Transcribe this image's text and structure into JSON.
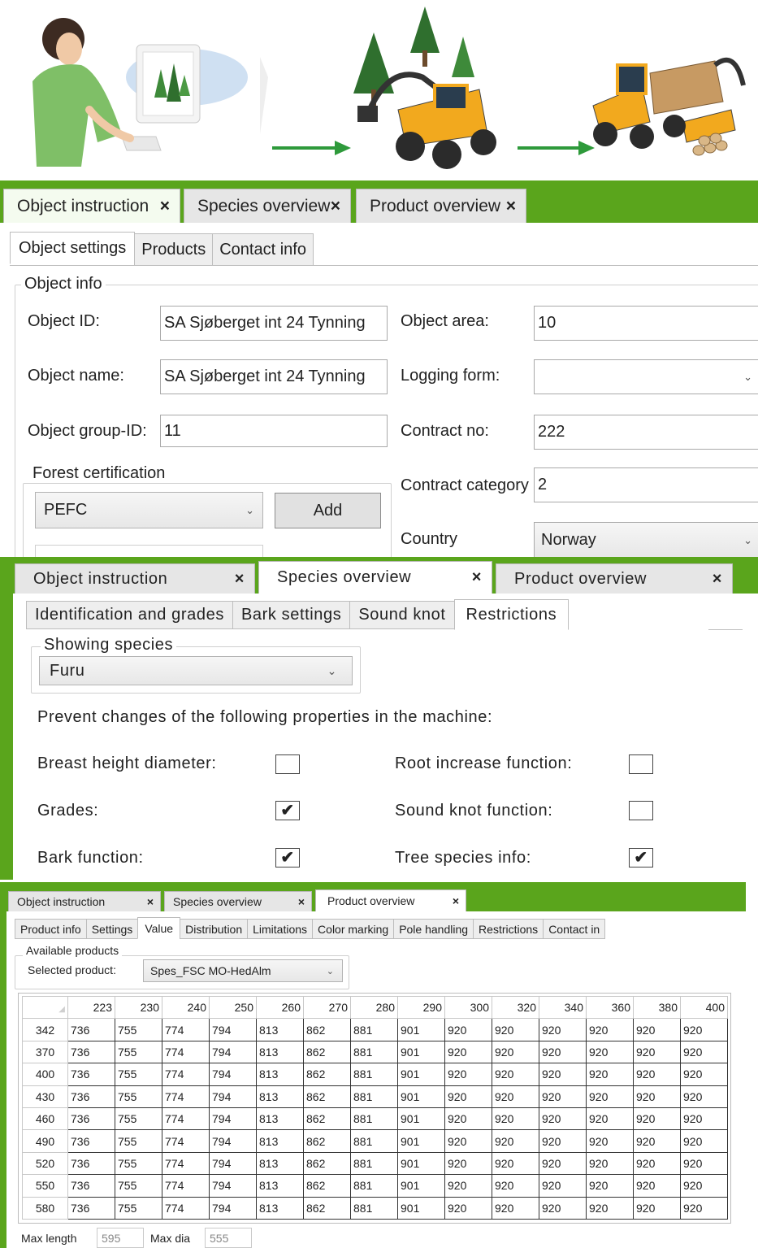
{
  "panel1": {
    "doc_tabs": [
      {
        "label": "Object instruction",
        "close": "×",
        "active": true
      },
      {
        "label": "Species overview",
        "close": "×",
        "active": false
      },
      {
        "label": "Product overview",
        "close": "×",
        "active": false
      }
    ],
    "sub_tabs": [
      "Object settings",
      "Products",
      "Contact info"
    ],
    "object_info": {
      "title": "Object info",
      "object_id_label": "Object ID:",
      "object_id": "SA Sjøberget int 24 Tynning",
      "object_name_label": "Object name:",
      "object_name": "SA Sjøberget int 24 Tynning",
      "object_group_label": "Object group-ID:",
      "object_group": "11",
      "object_area_label": "Object area:",
      "object_area": "10",
      "logging_form_label": "Logging form:",
      "logging_form": "",
      "contract_no_label": "Contract no:",
      "contract_no": "222",
      "contract_category_label": "Contract category",
      "contract_category": "2",
      "country_label": "Country",
      "country": "Norway"
    },
    "forest_certification": {
      "title": "Forest certification",
      "selected": "PEFC",
      "add_label": "Add"
    }
  },
  "panel2": {
    "doc_tabs": [
      {
        "label": "Object instruction",
        "close": "×",
        "active": false
      },
      {
        "label": "Species overview",
        "close": "×",
        "active": true
      },
      {
        "label": "Product overview",
        "close": "×",
        "active": false
      }
    ],
    "sub_tabs": [
      "Identification and grades",
      "Bark settings",
      "Sound knot",
      "Restrictions"
    ],
    "showing_species_title": "Showing species",
    "species": "Furu",
    "prevent_text": "Prevent changes of the following properties in the machine:",
    "checks": {
      "bhd_label": "Breast height diameter:",
      "bhd": false,
      "root_label": "Root increase function:",
      "root": false,
      "grades_label": "Grades:",
      "grades": true,
      "soundknot_label": "Sound knot function:",
      "soundknot": false,
      "bark_label": "Bark function:",
      "bark": true,
      "species_info_label": "Tree species info:",
      "species_info": true
    }
  },
  "panel3": {
    "doc_tabs": [
      {
        "label": "Object instruction",
        "close": "×",
        "active": false
      },
      {
        "label": "Species overview",
        "close": "×",
        "active": false
      },
      {
        "label": "Product overview",
        "close": "×",
        "active": true
      }
    ],
    "sub_tabs": [
      "Product info",
      "Settings",
      "Value",
      "Distribution",
      "Limitations",
      "Color marking",
      "Pole handling",
      "Restrictions",
      "Contact in"
    ],
    "available_products_title": "Available products",
    "selected_product_label": "Selected product:",
    "selected_product": "Spes_FSC MO-HedAlm",
    "grid": {
      "columns": [
        "223",
        "230",
        "240",
        "250",
        "260",
        "270",
        "280",
        "290",
        "300",
        "320",
        "340",
        "360",
        "380",
        "400"
      ],
      "rows": [
        {
          "h": "342",
          "v": [
            "736",
            "755",
            "774",
            "794",
            "813",
            "862",
            "881",
            "901",
            "920",
            "920",
            "920",
            "920",
            "920",
            "920"
          ]
        },
        {
          "h": "370",
          "v": [
            "736",
            "755",
            "774",
            "794",
            "813",
            "862",
            "881",
            "901",
            "920",
            "920",
            "920",
            "920",
            "920",
            "920"
          ]
        },
        {
          "h": "400",
          "v": [
            "736",
            "755",
            "774",
            "794",
            "813",
            "862",
            "881",
            "901",
            "920",
            "920",
            "920",
            "920",
            "920",
            "920"
          ]
        },
        {
          "h": "430",
          "v": [
            "736",
            "755",
            "774",
            "794",
            "813",
            "862",
            "881",
            "901",
            "920",
            "920",
            "920",
            "920",
            "920",
            "920"
          ]
        },
        {
          "h": "460",
          "v": [
            "736",
            "755",
            "774",
            "794",
            "813",
            "862",
            "881",
            "901",
            "920",
            "920",
            "920",
            "920",
            "920",
            "920"
          ]
        },
        {
          "h": "490",
          "v": [
            "736",
            "755",
            "774",
            "794",
            "813",
            "862",
            "881",
            "901",
            "920",
            "920",
            "920",
            "920",
            "920",
            "920"
          ]
        },
        {
          "h": "520",
          "v": [
            "736",
            "755",
            "774",
            "794",
            "813",
            "862",
            "881",
            "901",
            "920",
            "920",
            "920",
            "920",
            "920",
            "920"
          ]
        },
        {
          "h": "550",
          "v": [
            "736",
            "755",
            "774",
            "794",
            "813",
            "862",
            "881",
            "901",
            "920",
            "920",
            "920",
            "920",
            "920",
            "920"
          ]
        },
        {
          "h": "580",
          "v": [
            "736",
            "755",
            "774",
            "794",
            "813",
            "862",
            "881",
            "901",
            "920",
            "920",
            "920",
            "920",
            "920",
            "920"
          ]
        }
      ]
    },
    "max_length_label": "Max length",
    "max_length": "595",
    "max_dia_label": "Max dia",
    "max_dia": "555"
  },
  "colors": {
    "brand_green": "#5aa51c",
    "arrow_green": "#2e9a3b",
    "machine_yellow": "#f2a91e"
  }
}
